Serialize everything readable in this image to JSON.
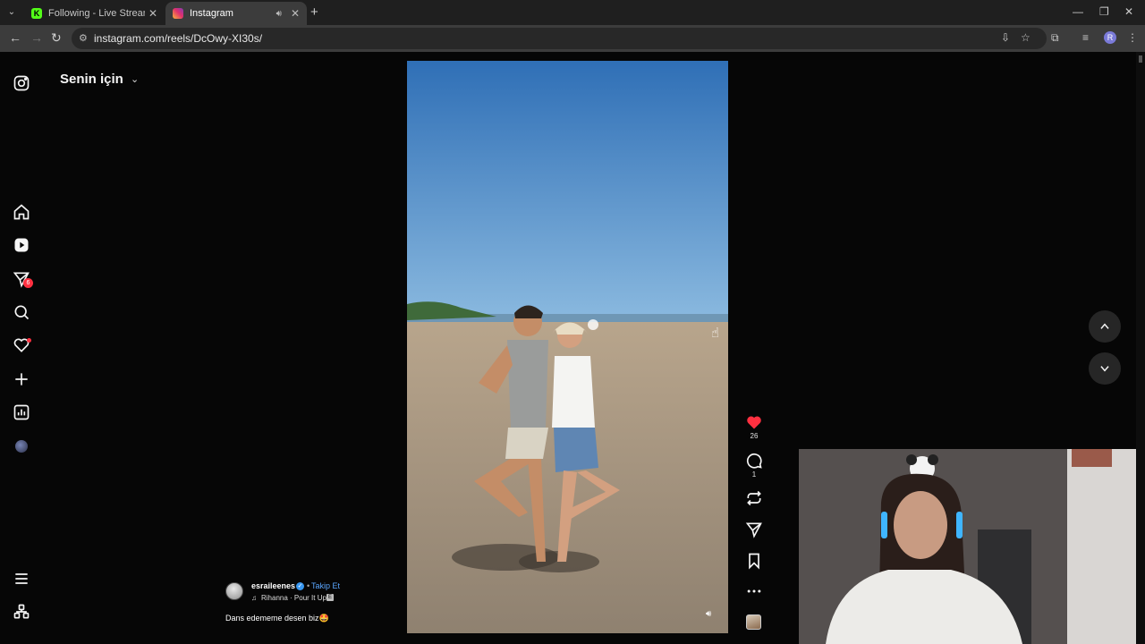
{
  "browser": {
    "tabs": [
      {
        "title": "Following - Live Streams on Kick",
        "favicon": "kick-icon",
        "active": false
      },
      {
        "title": "Instagram",
        "favicon": "instagram-icon",
        "active": true
      }
    ],
    "url": "instagram.com/reels/DcOwy-XI30s/",
    "profile_initial": "R"
  },
  "sidebar": {
    "items": [
      {
        "name": "home",
        "icon": "home-icon"
      },
      {
        "name": "reels",
        "icon": "reels-icon"
      },
      {
        "name": "messages",
        "icon": "messages-icon",
        "badge": "6"
      },
      {
        "name": "search",
        "icon": "search-icon"
      },
      {
        "name": "notifications",
        "icon": "heart-icon",
        "dot": true
      },
      {
        "name": "create",
        "icon": "plus-icon"
      },
      {
        "name": "dashboard",
        "icon": "dashboard-icon"
      },
      {
        "name": "profile",
        "icon": "avatar"
      }
    ],
    "bottom": [
      {
        "name": "more",
        "icon": "menu-icon"
      },
      {
        "name": "meta",
        "icon": "meta-icon"
      }
    ]
  },
  "feed": {
    "title": "Senin için"
  },
  "reel": {
    "likes": "26",
    "comments": "1",
    "liked": true,
    "author": "esraileenes",
    "follow_label": "Takip Et",
    "music": "Rihanna · Pour It Up",
    "caption": "Dans edememe desen biz🤩",
    "accent": "#ff3040",
    "link_color": "#5aa6ff"
  }
}
